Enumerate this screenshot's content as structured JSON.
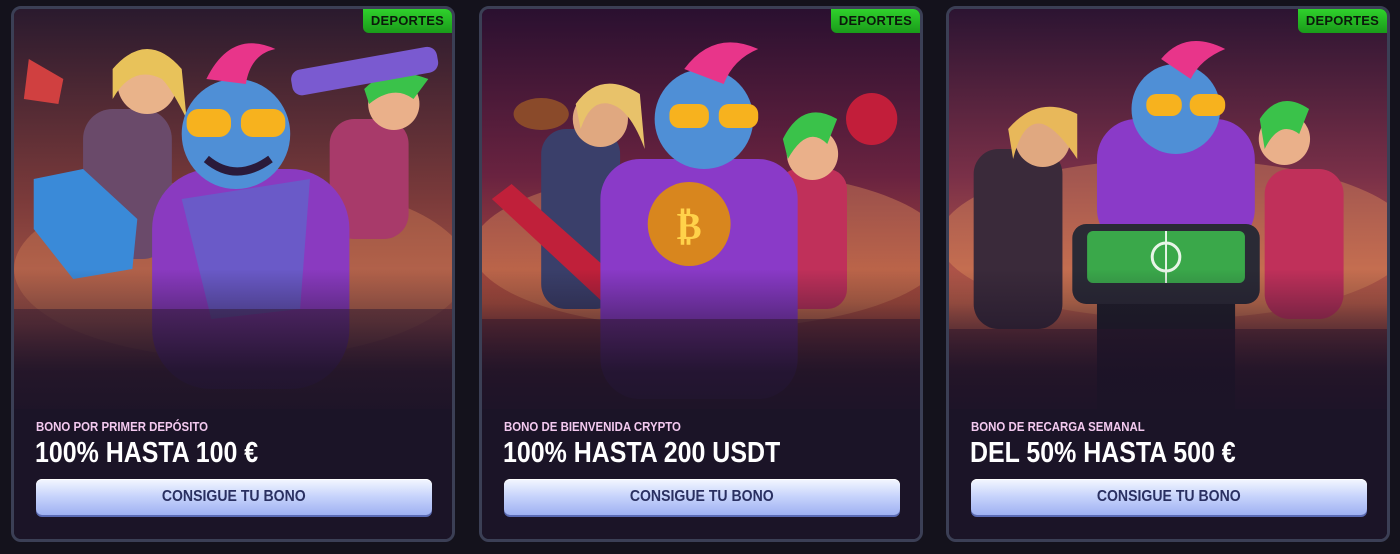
{
  "cards": [
    {
      "badge": "DEPORTES",
      "subtitle": "BONO POR PRIMER DEPÓSITO",
      "title": "100% HASTA 100 €",
      "button": "CONSIGUE TU BONO",
      "art": "cartoon-sports-fans-illustration"
    },
    {
      "badge": "DEPORTES",
      "subtitle": "BONO DE BIENVENIDA CRYPTO",
      "title": "100% HASTA 200 USDT",
      "button": "CONSIGUE TU BONO",
      "art": "cartoon-crypto-ball-illustration"
    },
    {
      "badge": "DEPORTES",
      "subtitle": "BONO DE RECARGA SEMANAL",
      "title": "DEL 50% HASTA 500 €",
      "button": "CONSIGUE TU BONO",
      "art": "cartoon-table-football-illustration"
    }
  ],
  "colors": {
    "badge_green": "#2fd12c",
    "subtitle_pink": "#f3c9ef",
    "button_blue": "#c5d2fb",
    "card_border": "#3b3f55"
  }
}
